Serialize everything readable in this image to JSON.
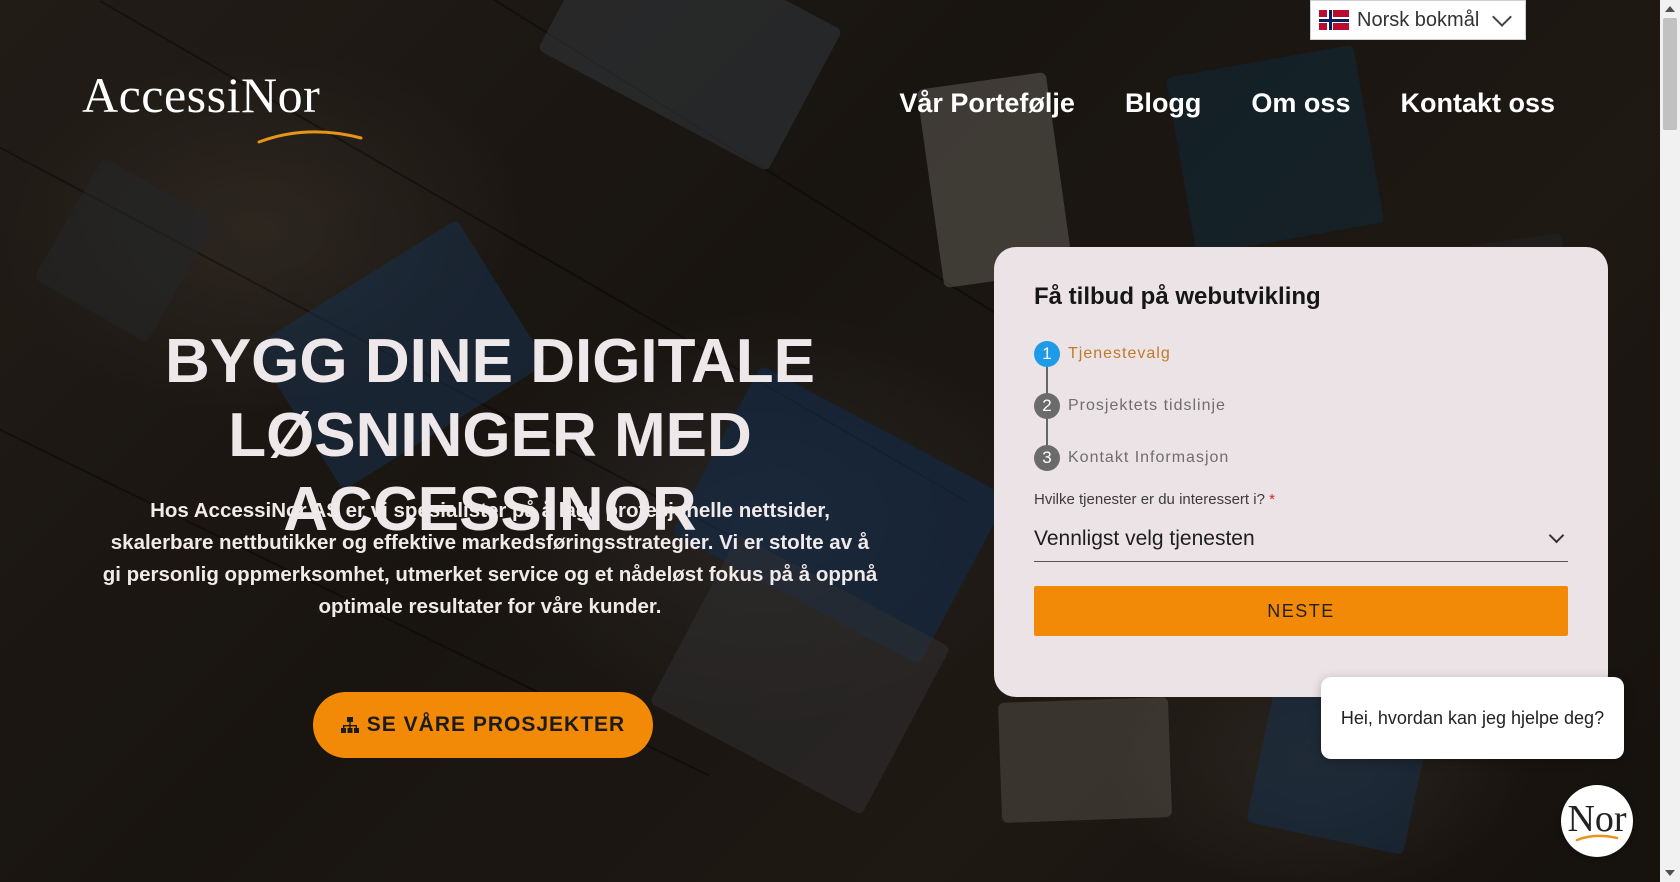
{
  "language": {
    "label": "Norsk bokmål",
    "flag_icon": "norway-flag-icon"
  },
  "logo": {
    "text": "AccessiNor",
    "swoosh_color": "#e8941a"
  },
  "nav": {
    "items": [
      {
        "label": "Vår Portefølje"
      },
      {
        "label": "Blogg"
      },
      {
        "label": "Om oss"
      },
      {
        "label": "Kontakt oss"
      }
    ]
  },
  "hero": {
    "title_line1": "BYGG DINE DIGITALE",
    "title_line2": "LØSNINGER MED ACCESSINOR",
    "description": "Hos AccessiNor AS er vi spesialister på å lage profesjonelle nettsider, skalerbare nettbutikker og effektive markedsføringsstrategier. Vi er stolte av å gi personlig oppmerksomhet, utmerket service og et nådeløst fokus på å oppnå optimale resultater for våre kunder.",
    "cta_label": "SE VÅRE PROSJEKTER",
    "cta_icon": "sitemap-icon"
  },
  "form": {
    "title": "Få tilbud på webutvikling",
    "steps": [
      {
        "num": "1",
        "label": "Tjenestevalg",
        "active": true
      },
      {
        "num": "2",
        "label": "Prosjektets tidslinje",
        "active": false
      },
      {
        "num": "3",
        "label": "Kontakt Informasjon",
        "active": false
      }
    ],
    "question_label": "Hvilke tjenester er du interessert i?",
    "required_mark": "*",
    "select_value": "Vennligst velg tjenesten",
    "next_label": "NESTE"
  },
  "chat": {
    "greeting": "Hei, hvordan kan jeg hjelpe deg?",
    "avatar_text": "Nor"
  },
  "colors": {
    "accent": "#f28a08",
    "step_active": "#1d9be6",
    "card_bg": "#ece3e6"
  }
}
